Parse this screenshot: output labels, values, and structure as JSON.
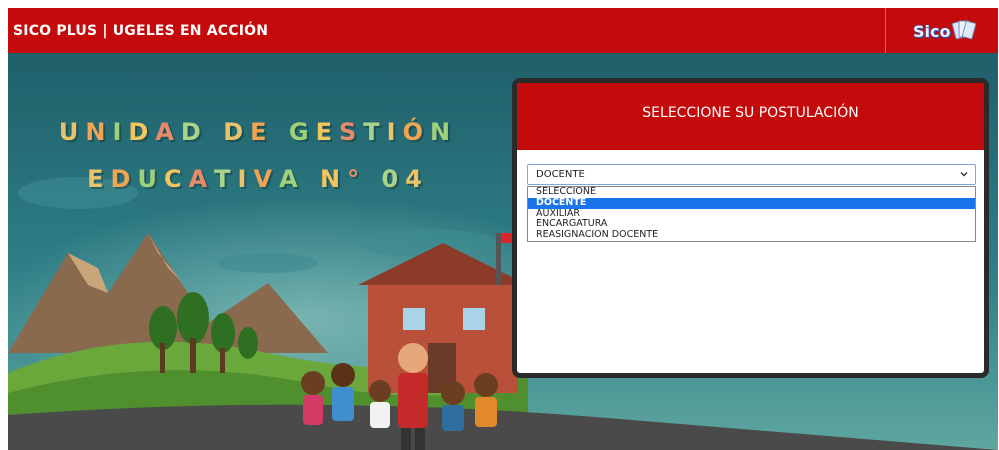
{
  "header": {
    "title": "SICO PLUS | UGELES EN ACCIÓN",
    "logo_text": "Sico",
    "bg_color": "#c40a0a"
  },
  "hero": {
    "line1": [
      "U",
      "N",
      "I",
      "D",
      "A",
      "D",
      " ",
      "D",
      "E",
      " ",
      "G",
      "E",
      "S",
      "T",
      "I",
      "Ó",
      "N"
    ],
    "line2": [
      "E",
      "D",
      "U",
      "C",
      "A",
      "T",
      "I",
      "V",
      "A",
      " ",
      "N",
      "°",
      " ",
      "0",
      "4"
    ],
    "letter_colors": [
      "#e9c36a",
      "#f0a552",
      "#9ed17a",
      "#f2c55d",
      "#e98a6a",
      "#a9d48a"
    ]
  },
  "modal": {
    "title": "SELECCIONE SU POSTULACIÓN",
    "select": {
      "selected": "DOCENTE",
      "options": [
        "SELECCIONE",
        "DOCENTE",
        "AUXILIAR",
        "ENCARGATURA",
        "REASIGNACION DOCENTE"
      ],
      "highlighted": "DOCENTE"
    }
  }
}
